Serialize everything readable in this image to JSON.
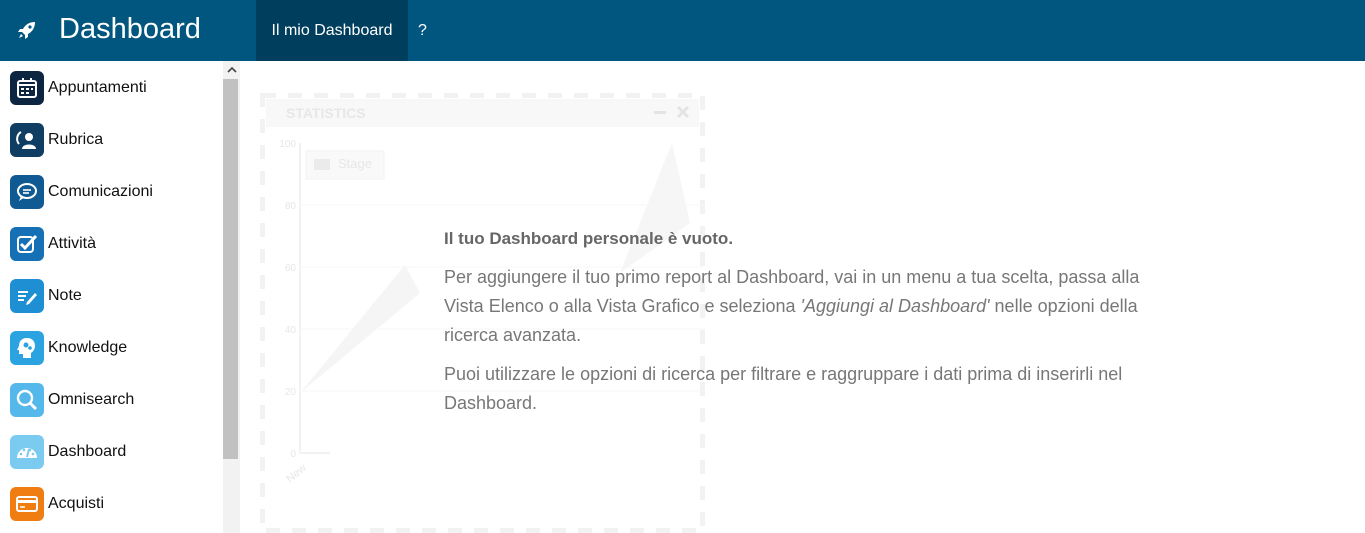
{
  "header": {
    "brand_title": "Dashboard",
    "brand_icon": "rocket-icon",
    "tabs": [
      {
        "label": "Il mio Dashboard",
        "active": true
      },
      {
        "label": "?",
        "active": false
      }
    ],
    "colors": {
      "bar": "#00567f",
      "active_tab": "#003e5d"
    }
  },
  "sidebar": {
    "items": [
      {
        "label": "Appuntamenti",
        "icon": "calendar-icon",
        "color": "#0d2540"
      },
      {
        "label": "Rubrica",
        "icon": "contacts-icon",
        "color": "#103e63"
      },
      {
        "label": "Comunicazioni",
        "icon": "chat-bubble-icon",
        "color": "#0f5a93"
      },
      {
        "label": "Attività",
        "icon": "checkmark-icon",
        "color": "#1570b5"
      },
      {
        "label": "Note",
        "icon": "note-pencil-icon",
        "color": "#1f8fd3"
      },
      {
        "label": "Knowledge",
        "icon": "head-gears-icon",
        "color": "#2aa3e0"
      },
      {
        "label": "Omnisearch",
        "icon": "magnifier-icon",
        "color": "#55b8ea"
      },
      {
        "label": "Dashboard",
        "icon": "gauge-icon",
        "color": "#7bcbf0"
      },
      {
        "label": "Acquisti",
        "icon": "credit-card-icon",
        "color": "#ef7d12"
      }
    ]
  },
  "empty_state": {
    "title": "Il tuo Dashboard personale è vuoto.",
    "p1_before": "Per aggiungere il tuo primo report al Dashboard, vai in un menu a tua scelta, passa alla Vista Elenco o alla Vista Grafico e seleziona ",
    "p1_em": "'Aggiungi al Dashboard'",
    "p1_after": " nelle opzioni della ricerca avanzata.",
    "p2": "Puoi utilizzare le opzioni di ricerca per filtrare e raggruppare i dati prima di inserirli nel Dashboard."
  },
  "ghost_widget": {
    "title": "STATISTICS",
    "legend": "Stage",
    "y_ticks": [
      "100",
      "80",
      "60",
      "40",
      "20",
      "0"
    ],
    "x_label": "New"
  }
}
